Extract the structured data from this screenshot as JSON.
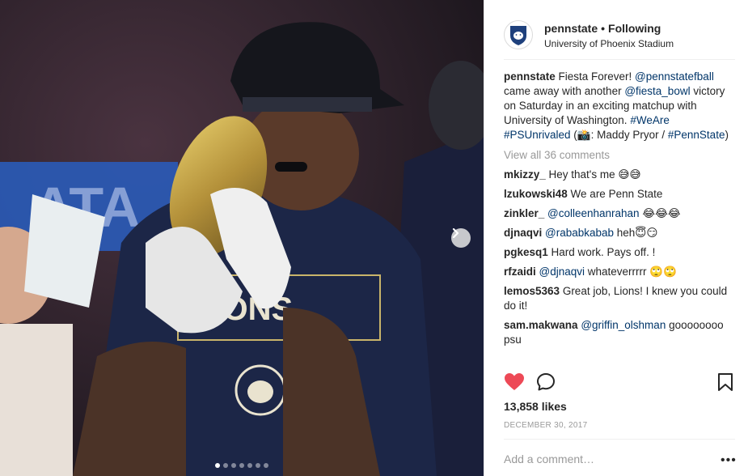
{
  "post": {
    "username": "pennstate",
    "separator": "•",
    "follow_status": "Following",
    "location": "University of Phoenix Stadium",
    "caption": {
      "username": "pennstate",
      "t1": " Fiesta Forever! ",
      "m1": "@pennstatefball",
      "t2": " came away with another ",
      "m2": "@fiesta_bowl",
      "t3": " victory on Saturday in an exciting matchup with University of Washington. ",
      "h1": "#WeAre",
      "h2": "#PSUnrivaled",
      "t4": " (📸: Maddy Pryor / ",
      "h3": "#PennState",
      "t5": ")"
    },
    "view_all": "View all 36 comments",
    "comments": [
      {
        "user": "mkizzy_",
        "text": " Hey that's me 😅😅",
        "mention": ""
      },
      {
        "user": "lzukowski48",
        "text": " We are Penn State",
        "mention": ""
      },
      {
        "user": "zinkler_",
        "mention": " @colleenhanrahan",
        "text": " 😂😂😂"
      },
      {
        "user": "djnaqvi",
        "mention": " @rababkabab",
        "text": " heh😇😏"
      },
      {
        "user": "pgkesq1",
        "text": " Hard work. Pays off. !",
        "mention": ""
      },
      {
        "user": "rfzaidi",
        "mention": " @djnaqvi",
        "text": " whateverrrrr 🙄🙄"
      },
      {
        "user": "lemos5363",
        "text": " Great job, Lions! I knew you could do it!",
        "mention": ""
      },
      {
        "user": "sam.makwana",
        "mention": " @griffin_olshman",
        "text": " goooooooo psu"
      }
    ],
    "likes": "13,858 likes",
    "date": "December 30, 2017",
    "add_comment_placeholder": "Add a comment…",
    "more": "•••"
  },
  "icons": {
    "like": "heart-icon",
    "comment": "speech-bubble-icon",
    "save": "bookmark-icon",
    "next": "chevron-right-icon"
  },
  "colors": {
    "like_red": "#ed4956",
    "link_blue": "#003569",
    "muted": "#999999"
  },
  "carousel": {
    "slide_count": 7,
    "active_index": 0
  }
}
